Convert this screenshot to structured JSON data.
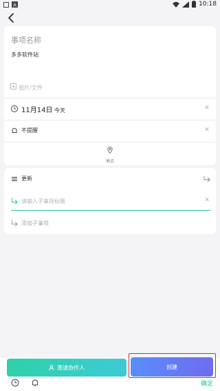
{
  "status_bar": {
    "time": "10:18"
  },
  "form": {
    "title_label": "事项名称",
    "content": "多多软件站",
    "attachment": "图片/文件",
    "date_main": "11月14日",
    "date_sub": "今天",
    "reminder": "不提醒",
    "location": "地点"
  },
  "subtasks": {
    "title": "更新",
    "input_placeholder": "请输入子事项标题",
    "add_label": "添加子事项"
  },
  "footer": {
    "invite_label": "邀请协作人",
    "create_label": "创建",
    "confirm_label": "确定"
  },
  "colors": {
    "accent_green": "#27c6a6",
    "accent_blue": "#5a8dfc",
    "highlight_red": "#d3272b"
  }
}
